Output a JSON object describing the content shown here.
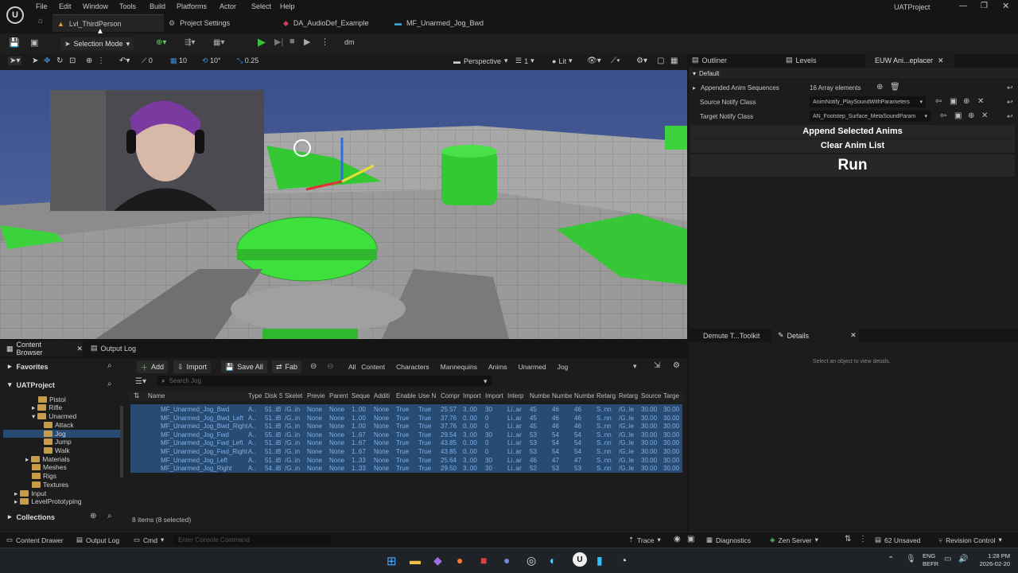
{
  "app": {
    "project_name": "UATProject"
  },
  "menu": [
    "File",
    "Edit",
    "Window",
    "Tools",
    "Build",
    "Platforms",
    "Actor",
    "Select",
    "Help"
  ],
  "doc_tabs": [
    "Lvl_ThirdPerson",
    "Project Settings",
    "DA_AudioDef_Example",
    "MF_Unarmed_Jog_Bwd"
  ],
  "toolbar": {
    "mode": "Selection Mode",
    "extra": "dm"
  },
  "viewport": {
    "view_mode": "Perspective",
    "lit": "Lit",
    "grid_1": "10",
    "grid_2": "10°",
    "scale": "0.25",
    "snap_0": "0",
    "camera_speed": "1"
  },
  "right_tabs": {
    "outliner": "Outliner",
    "levels": "Levels",
    "euw": "EUW Ani...eplacer"
  },
  "panel": {
    "category": "Default",
    "rows": [
      {
        "label": "Appended Anim Sequences",
        "value": "16 Array elements"
      },
      {
        "label": "Source Notify Class",
        "value": "AnimNotify_PlaySoundWithParameters"
      },
      {
        "label": "Target Notify Class",
        "value": "AN_Footstep_Surface_MetaSoundParam"
      }
    ],
    "append_btn": "Append Selected Anims",
    "clear_btn": "Clear Anim List",
    "run_btn": "Run"
  },
  "details": {
    "tab1": "Demute T...Toolkit",
    "tab2": "Details",
    "empty": "Select an object to view details."
  },
  "content_browser": {
    "tab": "Content Browser",
    "output_tab": "Output Log",
    "add": "Add",
    "import": "Import",
    "save_all": "Save All",
    "fab": "Fab",
    "breadcrumb": [
      "All",
      "Content",
      "Characters",
      "Mannequins",
      "Anims",
      "Unarmed",
      "Jog"
    ],
    "search_placeholder": "Search Jog",
    "favorites": "Favorites",
    "project": "UATProject",
    "collections": "Collections",
    "tree": [
      "Pistol",
      "Rifle",
      "Unarmed",
      "Attack",
      "Jog",
      "Jump",
      "Walk",
      "Materials",
      "Meshes",
      "Rigs",
      "Textures",
      "Input",
      "LevelPrototyping"
    ],
    "columns": [
      "Name",
      "Type",
      "Disk S",
      "Skelet",
      "Previe",
      "Parent",
      "Seque",
      "Additi",
      "Enable",
      "Use N",
      "Compr",
      "Import",
      "Import",
      "Interp",
      "Numbe",
      "Numbe",
      "Numbe",
      "Retarg",
      "Retarg",
      "Source",
      "Targe"
    ],
    "rows": [
      {
        "name": "MF_Unarmed_Jog_Bwd",
        "cols": [
          "A..",
          "51..iB",
          "/G..in",
          "None",
          "None",
          "1..00",
          "None",
          "True",
          "True",
          "25.57",
          "3..00",
          "30",
          "Li..ar",
          "45",
          "46",
          "46",
          "S..nn",
          "/G..le",
          "30.00",
          "30.00"
        ]
      },
      {
        "name": "MF_Unarmed_Jog_Bwd_Left",
        "cols": [
          "A..",
          "51..iB",
          "/G..in",
          "None",
          "None",
          "1..00",
          "None",
          "True",
          "True",
          "37.76",
          "0..00",
          "0",
          "Li..ar",
          "45",
          "46",
          "46",
          "S..nn",
          "/G..le",
          "30.00",
          "30.00"
        ]
      },
      {
        "name": "MF_Unarmed_Jog_Bwd_Right",
        "cols": [
          "A..",
          "51..iB",
          "/G..in",
          "None",
          "None",
          "1..00",
          "None",
          "True",
          "True",
          "37.76",
          "0..00",
          "0",
          "Li..ar",
          "45",
          "46",
          "46",
          "S..nn",
          "/G..le",
          "30.00",
          "30.00"
        ]
      },
      {
        "name": "MF_Unarmed_Jog_Fwd",
        "cols": [
          "A..",
          "55..iB",
          "/G..in",
          "None",
          "None",
          "1..67",
          "None",
          "True",
          "True",
          "29.54",
          "3..00",
          "30",
          "Li..ar",
          "53",
          "54",
          "54",
          "S..nn",
          "/G..le",
          "30.00",
          "30.00"
        ]
      },
      {
        "name": "MF_Unarmed_Jog_Fwd_Left",
        "cols": [
          "A..",
          "51..iB",
          "/G..in",
          "None",
          "None",
          "1..67",
          "None",
          "True",
          "True",
          "43.85",
          "0..00",
          "0",
          "Li..ar",
          "53",
          "54",
          "54",
          "S..nn",
          "/G..le",
          "30.00",
          "30.00"
        ]
      },
      {
        "name": "MF_Unarmed_Jog_Fwd_Right",
        "cols": [
          "A..",
          "51..iB",
          "/G..in",
          "None",
          "None",
          "1..67",
          "None",
          "True",
          "True",
          "43.85",
          "0..00",
          "0",
          "Li..ar",
          "53",
          "54",
          "54",
          "S..nn",
          "/G..le",
          "30.00",
          "30.00"
        ]
      },
      {
        "name": "MF_Unarmed_Jog_Left",
        "cols": [
          "A..",
          "51..iB",
          "/G..in",
          "None",
          "None",
          "1..33",
          "None",
          "True",
          "True",
          "25.64",
          "3..00",
          "30",
          "Li..ar",
          "46",
          "47",
          "47",
          "S..nn",
          "/G..le",
          "30.00",
          "30.00"
        ]
      },
      {
        "name": "MF_Unarmed_Jog_Right",
        "cols": [
          "A..",
          "54..iB",
          "/G..in",
          "None",
          "None",
          "1..33",
          "None",
          "True",
          "True",
          "29.50",
          "3..00",
          "30",
          "Li..ar",
          "52",
          "53",
          "53",
          "S..nn",
          "/G..le",
          "30.00",
          "30.00"
        ]
      }
    ],
    "items_count": "8 items (8 selected)"
  },
  "status": {
    "content_drawer": "Content Drawer",
    "output_log": "Output Log",
    "cmd": "Cmd",
    "console_placeholder": "Enter Console Command",
    "trace": "Trace",
    "diagnostics": "Diagnostics",
    "zen": "Zen Server",
    "unsaved": "62 Unsaved",
    "revision": "Revision Control"
  },
  "taskbar": {
    "lang1": "ENG",
    "lang2": "BEFR",
    "time": "1:28 PM",
    "date": "2026-02-20"
  },
  "colors": {
    "accent": "#0070e0",
    "green": "#3cd23c",
    "selected_row": "#284b73"
  }
}
